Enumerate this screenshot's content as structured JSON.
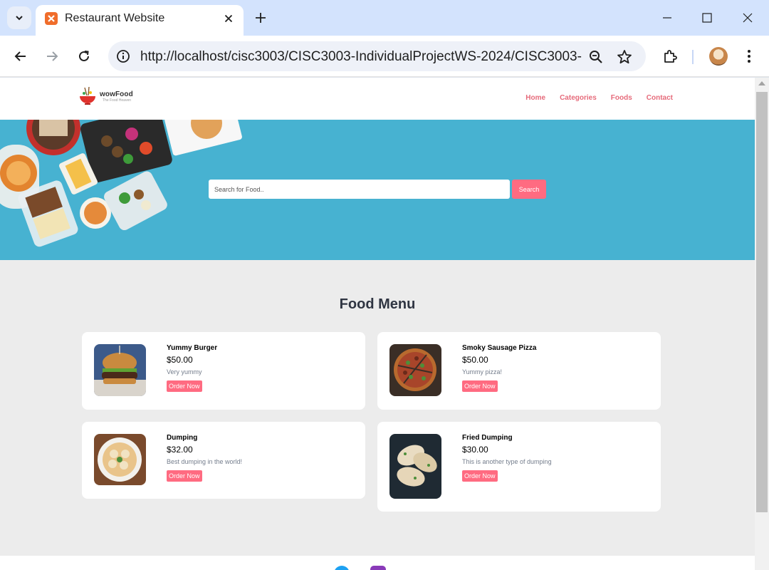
{
  "browser": {
    "tab_title": "Restaurant Website",
    "url": "http://localhost/cisc3003/CISC3003-IndividualProjectWS-2024/CISC3003-..."
  },
  "site": {
    "logo_name": "wowFood",
    "logo_tagline": "The Food Heaven",
    "nav": [
      "Home",
      "Categories",
      "Foods",
      "Contact"
    ],
    "search": {
      "placeholder": "Search for Food..",
      "button": "Search"
    },
    "section_title": "Food Menu",
    "foods": [
      {
        "name": "Yummy Burger",
        "price": "$50.00",
        "description": "Very yummy",
        "button": "Order Now"
      },
      {
        "name": "Smoky Sausage Pizza",
        "price": "$50.00",
        "description": "Yummy pizza!",
        "button": "Order Now"
      },
      {
        "name": "Dumping",
        "price": "$32.00",
        "description": "Best dumping in the world!",
        "button": "Order Now"
      },
      {
        "name": "Fried Dumping",
        "price": "$30.00",
        "description": "This is another type of dumping",
        "button": "Order Now"
      }
    ]
  },
  "colors": {
    "accent": "#ff6b81",
    "hero": "#47b2d1",
    "page_bg": "#ececec",
    "chrome_titlebar": "#d3e3fd"
  }
}
